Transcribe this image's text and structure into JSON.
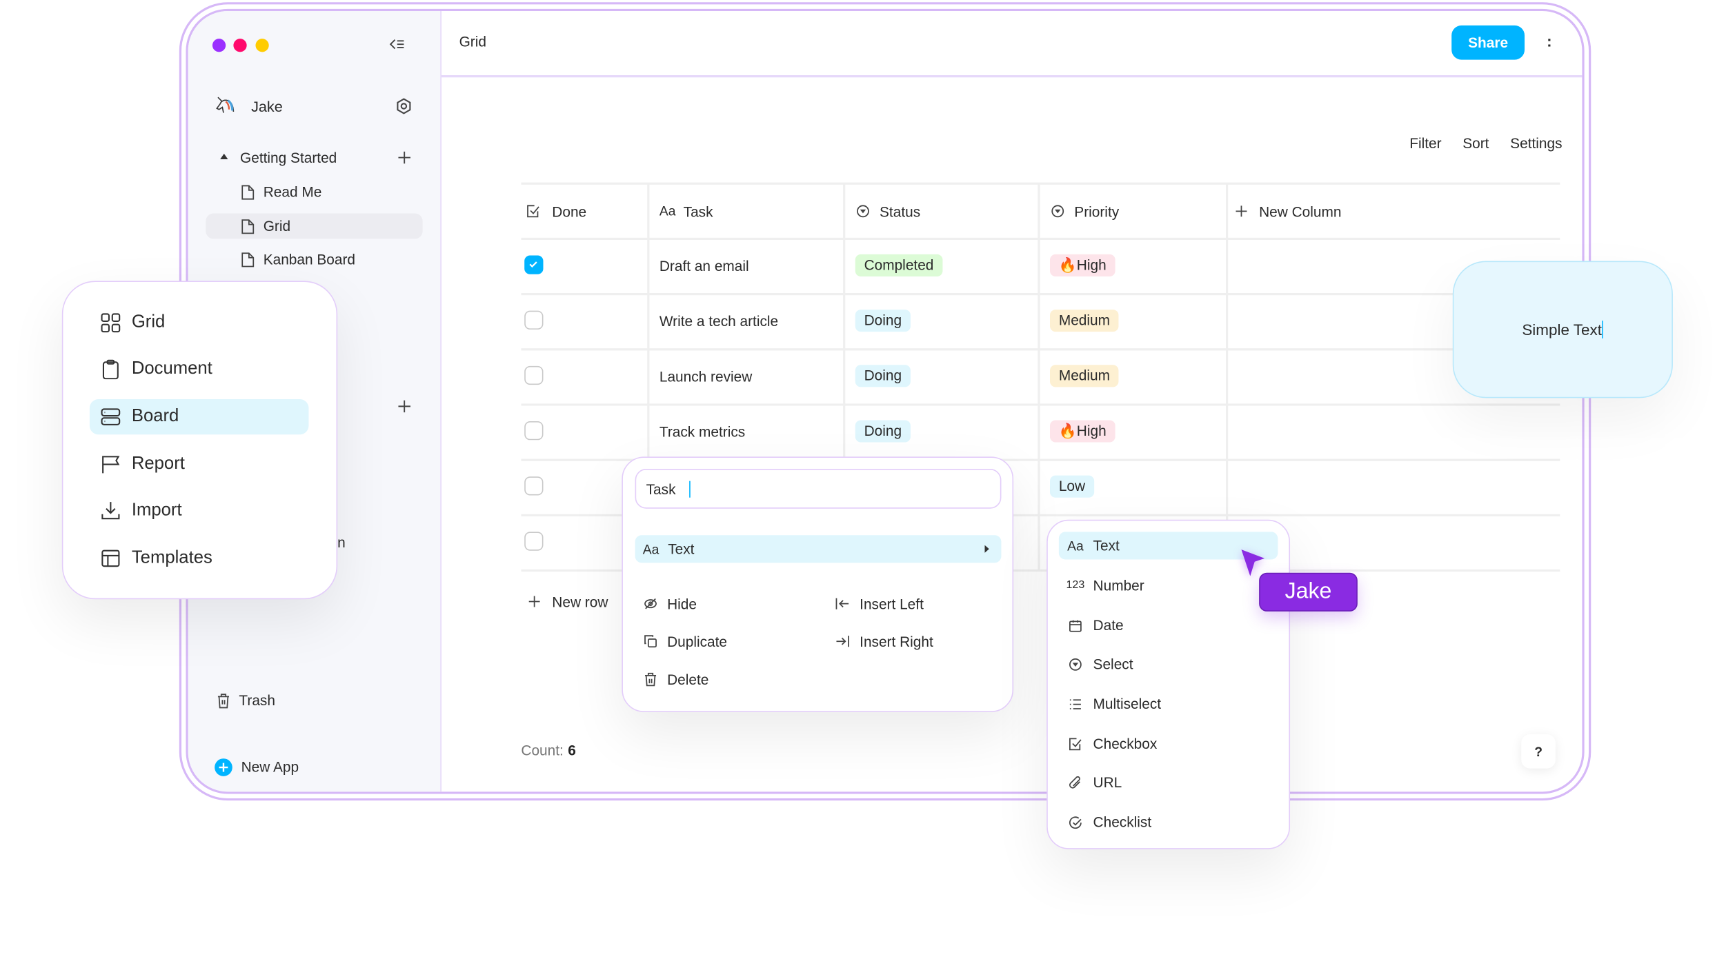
{
  "colors": {
    "accent": "#00b4ff",
    "border_purple": "#d6b8f7",
    "cursor_purple": "#8a2be2",
    "dot_purple": "#9b30ff",
    "dot_pink": "#ff0a6c",
    "dot_yellow": "#ffcc00"
  },
  "sidebar": {
    "user": "Jake",
    "section": "Getting Started",
    "pages": [
      {
        "label": "Read Me",
        "selected": false
      },
      {
        "label": "Grid",
        "selected": true
      },
      {
        "label": "Kanban Board",
        "selected": false
      }
    ],
    "partial_text": "n",
    "trash": "Trash",
    "new_app": "New App"
  },
  "header": {
    "title": "Grid",
    "share": "Share",
    "more": ":"
  },
  "toolbar": {
    "filter": "Filter",
    "sort": "Sort",
    "settings": "Settings"
  },
  "table": {
    "columns": [
      {
        "label": "Done",
        "icon": "checkbox-icon"
      },
      {
        "label": "Task",
        "icon": "text-icon"
      },
      {
        "label": "Status",
        "icon": "select-icon"
      },
      {
        "label": "Priority",
        "icon": "select-icon"
      },
      {
        "label": "New Column",
        "icon": "plus-icon"
      }
    ],
    "rows": [
      {
        "done": true,
        "task": "Draft an email",
        "status": "Completed",
        "priority": "High",
        "priority_emoji": "🔥"
      },
      {
        "done": false,
        "task": "Write a tech article",
        "status": "Doing",
        "priority": "Medium",
        "priority_emoji": ""
      },
      {
        "done": false,
        "task": "Launch review",
        "status": "Doing",
        "priority": "Medium",
        "priority_emoji": ""
      },
      {
        "done": false,
        "task": "Track metrics",
        "status": "Doing",
        "priority": "High",
        "priority_emoji": "🔥"
      },
      {
        "done": false,
        "task": "",
        "status": "",
        "priority": "Low",
        "priority_emoji": ""
      },
      {
        "done": false,
        "task": "",
        "status": "",
        "priority": "",
        "priority_emoji": ""
      }
    ],
    "new_row": "New row",
    "count_label": "Count:",
    "count_value": "6",
    "help": "?"
  },
  "view_menu": {
    "items": [
      {
        "label": "Grid",
        "icon": "grid-icon"
      },
      {
        "label": "Document",
        "icon": "clipboard-icon"
      },
      {
        "label": "Board",
        "icon": "board-icon",
        "selected": true
      },
      {
        "label": "Report",
        "icon": "flag-icon"
      },
      {
        "label": "Import",
        "icon": "download-icon"
      },
      {
        "label": "Templates",
        "icon": "layout-icon"
      }
    ]
  },
  "column_menu": {
    "name_value": "Task",
    "type": "Text",
    "type_icon": "Aa",
    "actions": {
      "hide": "Hide",
      "duplicate": "Duplicate",
      "delete": "Delete",
      "insert_left": "Insert Left",
      "insert_right": "Insert Right"
    }
  },
  "type_menu": {
    "items": [
      {
        "label": "Text",
        "icon": "Aa",
        "selected": true
      },
      {
        "label": "Number",
        "icon": "123"
      },
      {
        "label": "Date"
      },
      {
        "label": "Select"
      },
      {
        "label": "Multiselect"
      },
      {
        "label": "Checkbox"
      },
      {
        "label": "URL"
      },
      {
        "label": "Checklist"
      }
    ]
  },
  "collaborator": {
    "name": "Jake"
  },
  "text_card": {
    "value": "Simple Text"
  }
}
